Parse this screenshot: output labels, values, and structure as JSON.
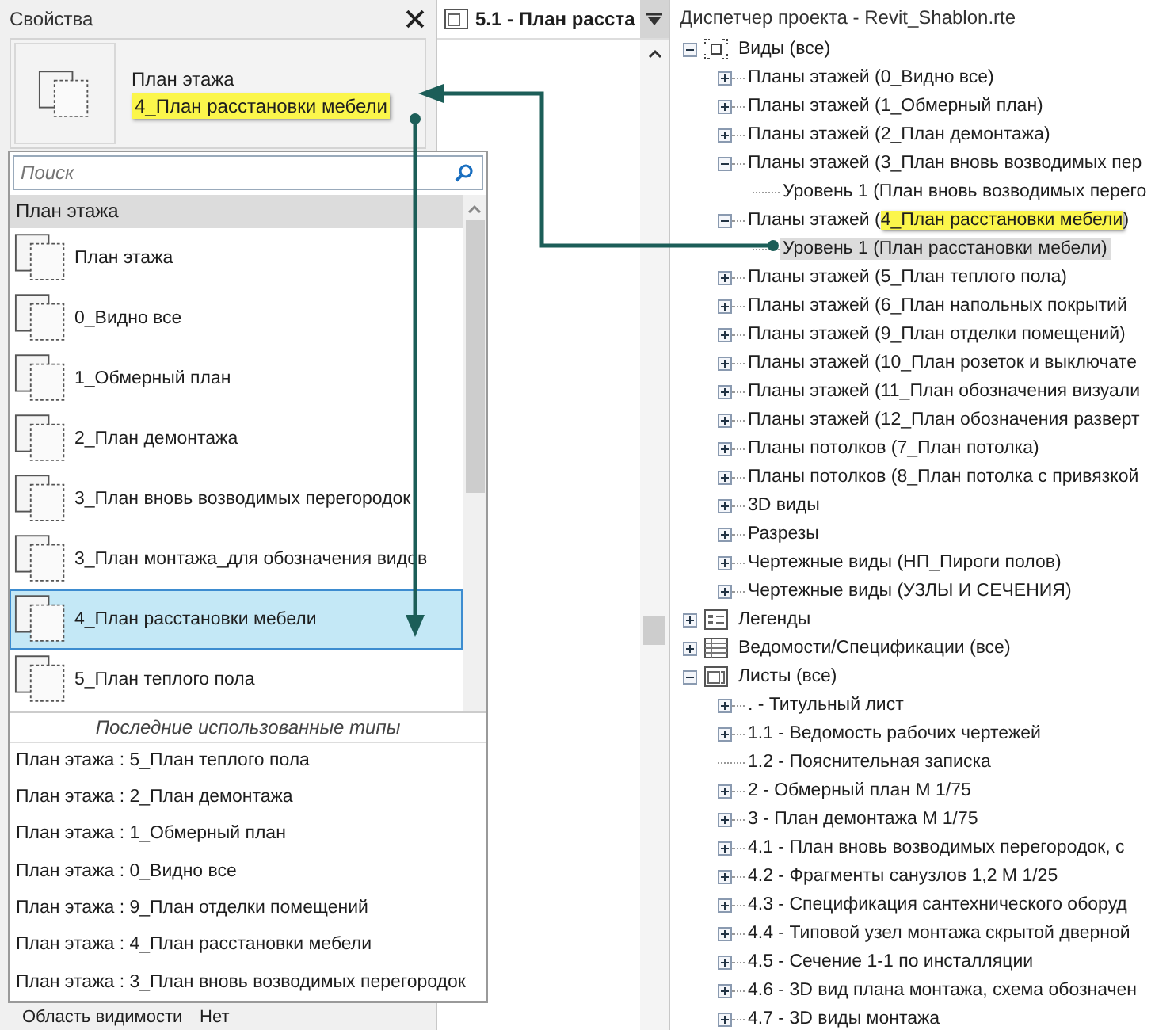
{
  "properties": {
    "title": "Свойства",
    "type_selector": {
      "family": "План этажа",
      "type": "4_План расстановки мебели",
      "highlighted": true
    },
    "hidden_row": {
      "name": "Область видимости",
      "value": "Нет"
    }
  },
  "type_dropdown": {
    "search": {
      "placeholder": "Поиск"
    },
    "group": "План этажа",
    "types": [
      {
        "label": "План этажа",
        "selected": false
      },
      {
        "label": "0_Видно все",
        "selected": false
      },
      {
        "label": "1_Обмерный план",
        "selected": false
      },
      {
        "label": "2_План демонтажа",
        "selected": false
      },
      {
        "label": "3_План вновь возводимых перегородок",
        "selected": false
      },
      {
        "label": "3_План монтажа_для обозначения видов",
        "selected": false
      },
      {
        "label": "4_План расстановки мебели",
        "selected": true
      },
      {
        "label": "5_План теплого пола",
        "selected": false
      }
    ],
    "recent_header": "Последние использованные типы",
    "recent": [
      "План этажа : 5_План теплого пола",
      "План этажа : 2_План демонтажа",
      "План этажа : 1_Обмерный план",
      "План этажа : 0_Видно все",
      "План этажа : 9_План отделки помещений",
      "План этажа : 4_План расстановки мебели",
      "План этажа : 3_План вновь возводимых перегородок"
    ]
  },
  "view_tab": {
    "title": "5.1 - План расста"
  },
  "project_browser": {
    "title": "Диспетчер проекта - Revit_Shablon.rte",
    "tree": [
      {
        "kind": "views",
        "label": "Виды (все)",
        "expanded": true,
        "selected": false,
        "children": [
          {
            "label": "Планы этажей (0_Видно все)",
            "expanded": false,
            "selected": false
          },
          {
            "label": "Планы этажей (1_Обмерный план)",
            "expanded": false,
            "selected": false
          },
          {
            "label": "Планы этажей (2_План демонтажа)",
            "expanded": false,
            "selected": false
          },
          {
            "label": "Планы этажей (3_План вновь возводимых пер",
            "expanded": true,
            "selected": false,
            "children": [
              {
                "label": "Уровень 1 (План вновь возводимых перего",
                "selected": false
              }
            ]
          },
          {
            "label": "Планы этажей (",
            "highlight": "4_План расстановки мебели",
            "suffix": ")",
            "expanded": true,
            "selected": false,
            "children": [
              {
                "label": "Уровень 1 (План расстановки мебели)",
                "selected": true
              }
            ]
          },
          {
            "label": "Планы этажей (5_План теплого пола)",
            "expanded": false,
            "selected": false
          },
          {
            "label": "Планы этажей (6_План напольных покрытий",
            "expanded": false,
            "selected": false
          },
          {
            "label": "Планы этажей (9_План отделки помещений)",
            "expanded": false,
            "selected": false
          },
          {
            "label": "Планы этажей (10_План розеток и выключате",
            "expanded": false,
            "selected": false
          },
          {
            "label": "Планы этажей (11_План обозначения визуали",
            "expanded": false,
            "selected": false
          },
          {
            "label": "Планы этажей (12_План обозначения разверт",
            "expanded": false,
            "selected": false
          },
          {
            "label": "Планы потолков (7_План потолка)",
            "expanded": false,
            "selected": false
          },
          {
            "label": "Планы потолков (8_План потолка с привязкой",
            "expanded": false,
            "selected": false
          },
          {
            "label": "3D виды",
            "expanded": false,
            "selected": false
          },
          {
            "label": "Разрезы",
            "expanded": false,
            "selected": false
          },
          {
            "label": "Чертежные виды (НП_Пироги полов)",
            "expanded": false,
            "selected": false
          },
          {
            "label": "Чертежные виды (УЗЛЫ И СЕЧЕНИЯ)",
            "expanded": false,
            "selected": false
          }
        ]
      },
      {
        "kind": "legends",
        "label": "Легенды",
        "expanded": false,
        "selected": false
      },
      {
        "kind": "schedules",
        "label": "Ведомости/Спецификации (все)",
        "expanded": false,
        "selected": false
      },
      {
        "kind": "sheets",
        "label": "Листы (все)",
        "expanded": true,
        "selected": false,
        "children": [
          {
            "label": ". - Титульный лист",
            "expanded": false,
            "selected": false
          },
          {
            "label": "1.1 - Ведомость рабочих чертежей",
            "expanded": false,
            "selected": false
          },
          {
            "label": "1.2 - Пояснительная записка",
            "selected": false
          },
          {
            "label": "2 - Обмерный план М 1/75",
            "expanded": false,
            "selected": false
          },
          {
            "label": "3 - План демонтажа М 1/75",
            "expanded": false,
            "selected": false
          },
          {
            "label": "4.1 - План вновь возводимых перегородок, с",
            "expanded": false,
            "selected": false
          },
          {
            "label": "4.2 - Фрагменты санузлов 1,2 М 1/25",
            "expanded": false,
            "selected": false
          },
          {
            "label": "4.3 - Спецификация сантехнического оборуд",
            "expanded": false,
            "selected": false
          },
          {
            "label": "4.4 - Типовой узел монтажа скрытой дверной",
            "expanded": false,
            "selected": false
          },
          {
            "label": "4.5 - Сечение 1-1 по инсталляции",
            "expanded": false,
            "selected": false
          },
          {
            "label": "4.6 - 3D вид плана монтажа, схема обозначен",
            "expanded": false,
            "selected": false
          },
          {
            "label": "4.7 - 3D виды монтажа",
            "expanded": false,
            "selected": false
          }
        ]
      }
    ]
  }
}
